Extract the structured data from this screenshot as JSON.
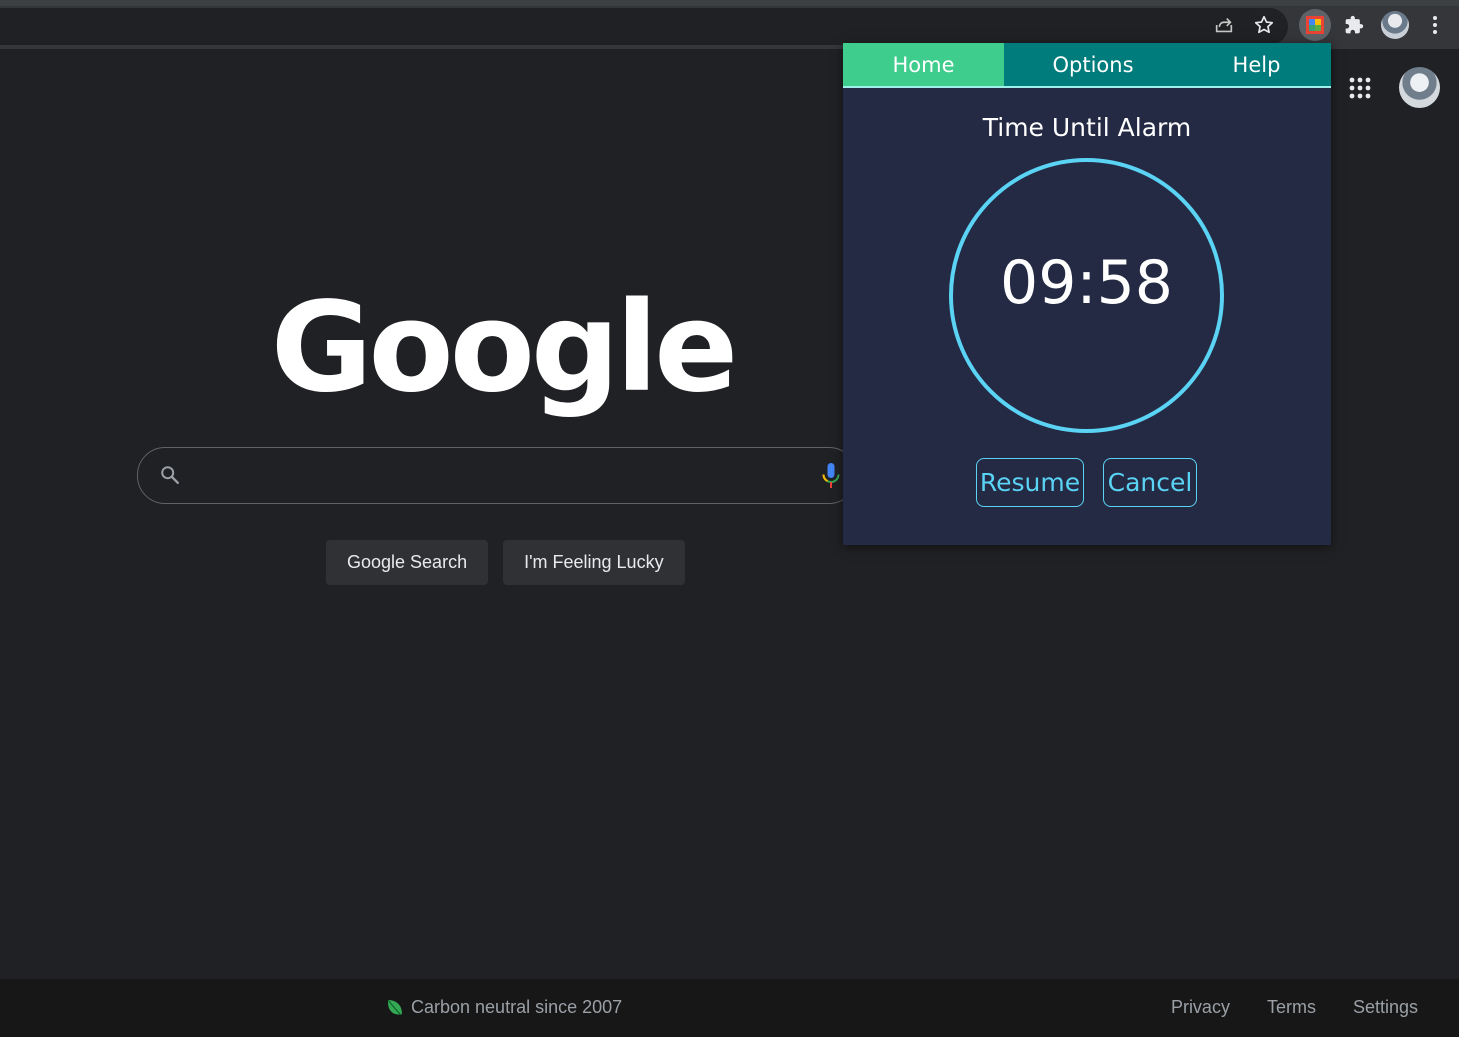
{
  "browser": {
    "toolbar_icons": [
      "share-icon",
      "star-icon",
      "extension-icon",
      "puzzle-icon",
      "avatar",
      "more-vert-icon"
    ]
  },
  "google": {
    "logo_text": "Google",
    "search_placeholder": "",
    "buttons": {
      "search": "Google Search",
      "lucky": "I'm Feeling Lucky"
    }
  },
  "footer": {
    "carbon": "Carbon neutral since 2007",
    "links": [
      "Privacy",
      "Terms",
      "Settings"
    ]
  },
  "popup": {
    "tabs": [
      "Home",
      "Options",
      "Help"
    ],
    "active_tab": "Home",
    "title": "Time Until Alarm",
    "countdown": "09:58",
    "resume_label": "Resume",
    "cancel_label": "Cancel",
    "colors": {
      "accent": "#5ad3f4",
      "tab_active": "#3ecd8c",
      "tab_bar": "#007c7c",
      "background": "#242a44"
    }
  }
}
